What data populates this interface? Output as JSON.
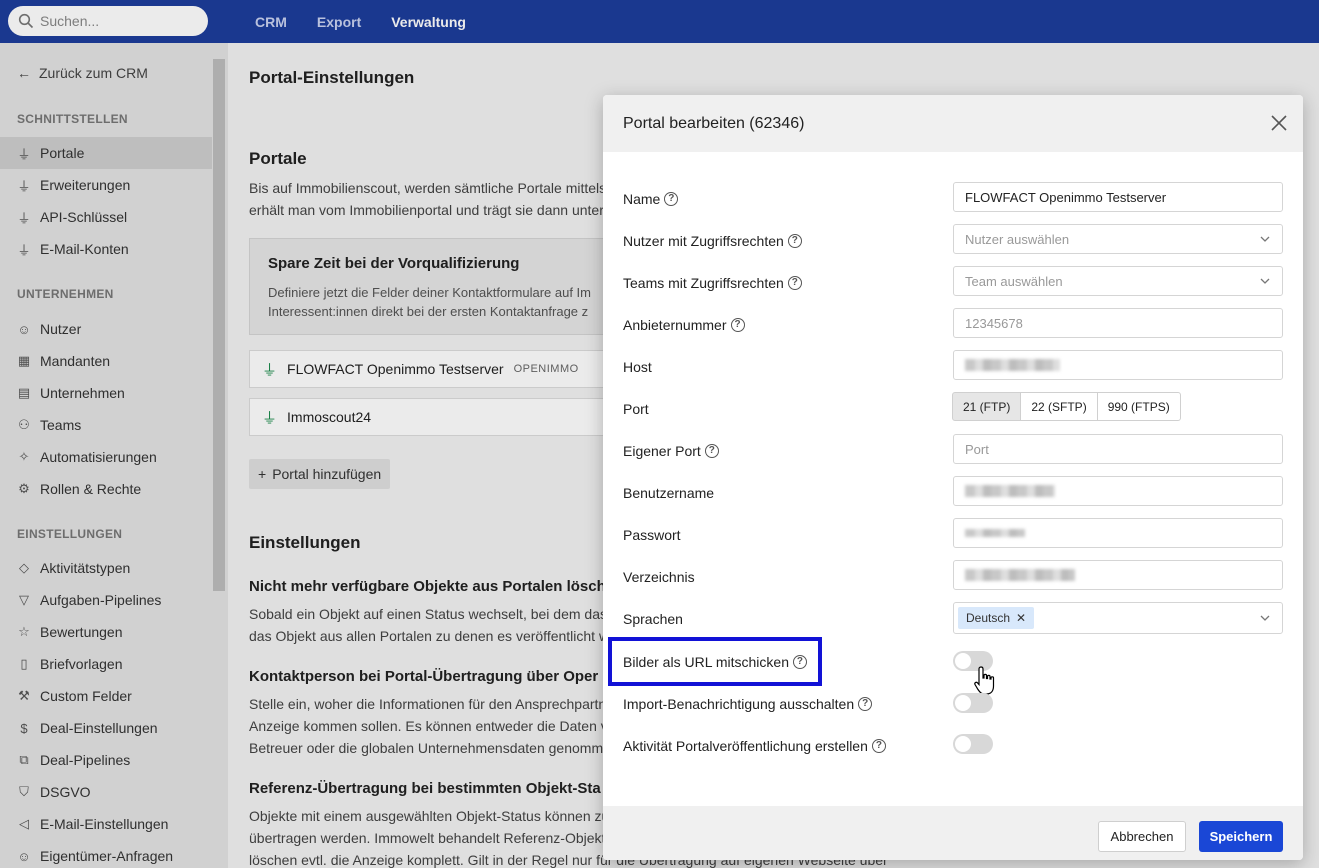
{
  "search": {
    "placeholder": "Suchen..."
  },
  "topnav": [
    "CRM",
    "Export",
    "Verwaltung"
  ],
  "sidebar": {
    "back": "Zurück zum CRM",
    "sections": {
      "schnittstellen": "SCHNITTSTELLEN",
      "unternehmen": "UNTERNEHMEN",
      "einstellungen": "EINSTELLUNGEN"
    },
    "items": [
      "Portale",
      "Erweiterungen",
      "API-Schlüssel",
      "E-Mail-Konten",
      "Nutzer",
      "Mandanten",
      "Unternehmen",
      "Teams",
      "Automatisierungen",
      "Rollen & Rechte",
      "Aktivitätstypen",
      "Aufgaben-Pipelines",
      "Bewertungen",
      "Briefvorlagen",
      "Custom Felder",
      "Deal-Einstellungen",
      "Deal-Pipelines",
      "DSGVO",
      "E-Mail-Einstellungen",
      "Eigentümer-Anfragen"
    ]
  },
  "main": {
    "title": "Portal-Einstellungen",
    "portale_heading": "Portale",
    "portale_desc": [
      "Bis auf Immobilienscout, werden sämtliche Portale mittels i",
      "erhält man vom Immobilienportal und trägt sie dann unter"
    ],
    "promo_title": "Spare Zeit bei der Vorqualifizierung",
    "promo_desc": [
      "Definiere jetzt die Felder deiner Kontaktformulare auf Im",
      "Interessent:innen direkt bei der ersten Kontaktanfrage z"
    ],
    "portals": [
      {
        "name": "FLOWFACT Openimmo Testserver",
        "tag": "OPENIMMO"
      },
      {
        "name": "Immoscout24",
        "tag": ""
      }
    ],
    "add_portal": "Portal hinzufügen",
    "einstellungen_heading": "Einstellungen",
    "s1_title": "Nicht mehr verfügbare Objekte aus Portalen lösch",
    "s1_desc": [
      "Sobald ein Objekt auf einen Status wechselt, bei dem das O",
      "das Objekt aus allen Portalen zu denen es veröffentlicht wu"
    ],
    "s2_title": "Kontaktperson bei Portal-Übertragung über Oper",
    "s2_desc": [
      "Stelle ein, woher die Informationen für den Ansprechpartne",
      "Anzeige kommen sollen. Es können entweder die Daten vo",
      "Betreuer oder die globalen Unternehmensdaten genomme"
    ],
    "s3_title": "Referenz-Übertragung bei bestimmten Objekt-Sta",
    "s3_desc": [
      "Objekte mit einem ausgewählten Objekt-Status können zu",
      "übertragen werden. Immowelt behandelt Referenz-Objekte",
      "löschen evtl. die Anzeige komplett. Gilt in der Regel nur für die Übertragung auf eigenen Webseite über"
    ]
  },
  "modal": {
    "title": "Portal bearbeiten (62346)",
    "labels": {
      "name": "Name",
      "nutzer": "Nutzer mit Zugriffsrechten",
      "teams": "Teams mit Zugriffsrechten",
      "anbieter": "Anbieternummer",
      "host": "Host",
      "port": "Port",
      "eigener_port": "Eigener Port",
      "benutzername": "Benutzername",
      "passwort": "Passwort",
      "verzeichnis": "Verzeichnis",
      "sprachen": "Sprachen",
      "bilder": "Bilder als URL mitschicken",
      "import": "Import-Benachrichtigung ausschalten",
      "aktivitaet": "Aktivität Portalveröffentlichung erstellen"
    },
    "name_value": "FLOWFACT Openimmo Testserver",
    "nutzer_placeholder": "Nutzer auswählen",
    "teams_placeholder": "Team auswählen",
    "anbieter_placeholder": "12345678",
    "port_options": [
      "21 (FTP)",
      "22 (SFTP)",
      "990 (FTPS)"
    ],
    "port_selected": "21 (FTP)",
    "eigener_port_placeholder": "Port",
    "sprache_chip": "Deutsch",
    "toggles": {
      "bilder": false,
      "import": false,
      "aktivitaet": false
    },
    "cancel": "Abbrechen",
    "save": "Speichern"
  }
}
